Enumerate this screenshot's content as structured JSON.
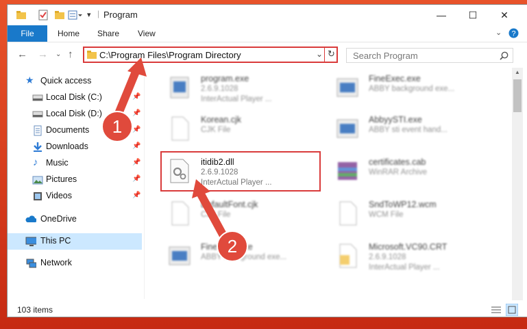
{
  "window": {
    "title": "Program",
    "minimize": "—",
    "maximize": "☐",
    "close": "✕"
  },
  "ribbon": {
    "file": "File",
    "tabs": [
      "Home",
      "Share",
      "View"
    ]
  },
  "address": {
    "path": "C:\\Program Files\\Program Directory",
    "search_placeholder": "Search Program"
  },
  "sidebar": {
    "items": [
      {
        "label": "Quick access",
        "icon": "star-icon"
      },
      {
        "label": "Local Disk (C:)",
        "icon": "disk-icon"
      },
      {
        "label": "Local Disk (D:)",
        "icon": "disk-icon"
      },
      {
        "label": "Documents",
        "icon": "documents-icon"
      },
      {
        "label": "Downloads",
        "icon": "downloads-icon"
      },
      {
        "label": "Music",
        "icon": "music-icon"
      },
      {
        "label": "Pictures",
        "icon": "pictures-icon"
      },
      {
        "label": "Videos",
        "icon": "videos-icon"
      },
      {
        "label": "OneDrive",
        "icon": "cloud-icon"
      },
      {
        "label": "This PC",
        "icon": "pc-icon"
      },
      {
        "label": "Network",
        "icon": "network-icon"
      }
    ]
  },
  "files": [
    {
      "name": "program.exe",
      "line1": "2.6.9.1028",
      "line2": "InterActual Player ..."
    },
    {
      "name": "FineExec.exe",
      "line1": "ABBY background exe...",
      "line2": ""
    },
    {
      "name": "Korean.cjk",
      "line1": "CJK File",
      "line2": ""
    },
    {
      "name": "AbbyySTI.exe",
      "line1": "ABBY sti event hand...",
      "line2": ""
    },
    {
      "name": "itidib2.dll",
      "line1": "2.6.9.1028",
      "line2": "InterActual Player ..."
    },
    {
      "name": "certificates.cab",
      "line1": "WinRAR Archive",
      "line2": ""
    },
    {
      "name": "DefaultFont.cjk",
      "line1": "CJK File",
      "line2": ""
    },
    {
      "name": "SndToWP12.wcm",
      "line1": "WCM File",
      "line2": ""
    },
    {
      "name": "FineExec.exe",
      "line1": "ABBY background exe...",
      "line2": ""
    },
    {
      "name": "Microsoft.VC90.CRT",
      "line1": "2.6.9.1028",
      "line2": "InterActual Player ..."
    }
  ],
  "status": {
    "count": "103 items"
  },
  "callouts": [
    "1",
    "2"
  ],
  "colors": {
    "accent": "#1979ca",
    "highlight": "#d93a3a",
    "badge": "#e04a3c"
  }
}
